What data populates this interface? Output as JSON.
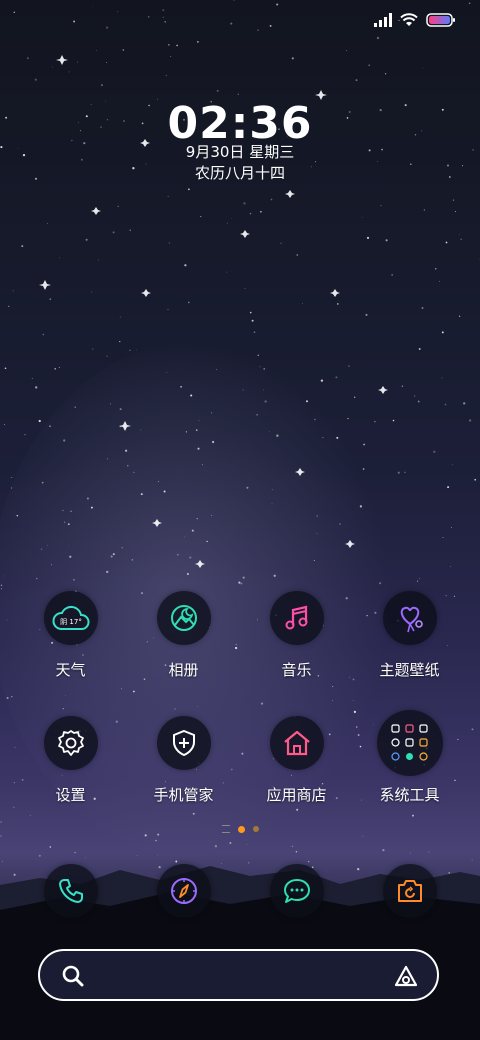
{
  "status_bar": {
    "icons": [
      "signal-icon",
      "wifi-icon",
      "battery-icon"
    ],
    "battery_gradient": [
      "#ff3e7f",
      "#5a7bff"
    ]
  },
  "lockclock": {
    "time": "02:36",
    "date": "9月30日 星期三",
    "lunar": "农历八月十四"
  },
  "weather_widget": {
    "condition": "阴",
    "temperature": "17°"
  },
  "apps_row1": [
    {
      "label": "天气",
      "icon": "weather-cloud-icon",
      "color": "#37e0c8"
    },
    {
      "label": "相册",
      "icon": "gallery-icon",
      "color": "#2ee0b0"
    },
    {
      "label": "音乐",
      "icon": "music-note-icon",
      "color": "#ff4fa8"
    },
    {
      "label": "主题壁纸",
      "icon": "theme-heart-balloon-icon",
      "color": "#9b6bff"
    }
  ],
  "apps_row2": [
    {
      "label": "设置",
      "icon": "gear-icon",
      "color": "#ffffff"
    },
    {
      "label": "手机管家",
      "icon": "shield-plus-icon",
      "color": "#ffffff"
    },
    {
      "label": "应用商店",
      "icon": "store-house-icon",
      "color": "#ff5a8a"
    },
    {
      "label": "系统工具",
      "icon": "folder-tools-icon",
      "color": "#ffffff"
    }
  ],
  "page_indicator": {
    "pages": 3,
    "active": 1
  },
  "dock": [
    {
      "icon": "phone-icon",
      "color": "#37e0c8"
    },
    {
      "icon": "browser-compass-icon",
      "color": "#9b6bff"
    },
    {
      "icon": "messages-icon",
      "color": "#2ee0b0"
    },
    {
      "icon": "camera-icon",
      "color": "#ff8a2a"
    }
  ],
  "search_bar": {
    "icon": "search-icon",
    "right_icon": "assistant-icon"
  }
}
